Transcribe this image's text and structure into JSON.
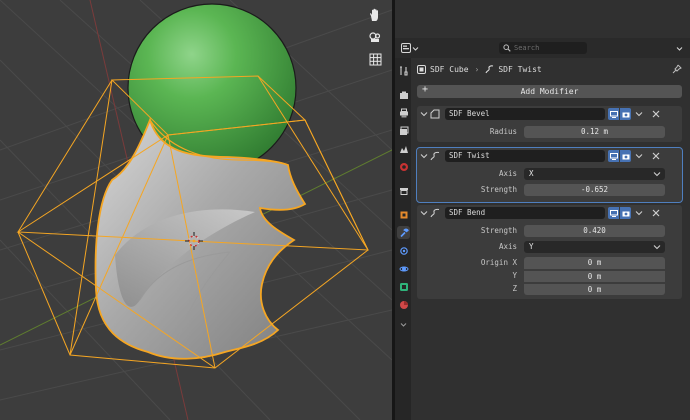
{
  "properties": {
    "search": {
      "placeholder": "Search"
    },
    "breadcrumb": {
      "object": "SDF Cube",
      "modifier": "SDF Twist"
    },
    "add_modifier_label": "Add Modifier",
    "tabs": [
      {
        "name": "tool-tab",
        "icon": "wrench-screwdriver-icon"
      },
      {
        "name": "render-tab",
        "icon": "camera-back-icon"
      },
      {
        "name": "output-tab",
        "icon": "printer-icon"
      },
      {
        "name": "view-layer-tab",
        "icon": "image-stack-icon"
      },
      {
        "name": "scene-tab",
        "icon": "scene-icon"
      },
      {
        "name": "world-tab",
        "icon": "world-icon"
      },
      {
        "name": "collection-tab",
        "icon": "collection-box-icon"
      },
      {
        "name": "object-tab",
        "icon": "object-square-icon"
      },
      {
        "name": "modifier-tab",
        "icon": "wrench-icon"
      },
      {
        "name": "particles-tab",
        "icon": "particles-icon"
      },
      {
        "name": "physics-tab",
        "icon": "physics-orbit-icon"
      },
      {
        "name": "constraints-tab",
        "icon": "constraint-icon"
      },
      {
        "name": "data-tab",
        "icon": "data-green-icon"
      },
      {
        "name": "material-tab",
        "icon": "material-sphere-icon"
      }
    ],
    "modifiers": [
      {
        "name": "SDF Bevel",
        "fields": [
          {
            "label": "Radius",
            "value": "0.12 m"
          }
        ]
      },
      {
        "name": "SDF Twist",
        "fields": [
          {
            "label": "Axis",
            "value": "X"
          },
          {
            "label": "Strength",
            "value": "-0.652"
          }
        ]
      },
      {
        "name": "SDF Bend",
        "fields": [
          {
            "label": "Strength",
            "value": "0.420"
          },
          {
            "label": "Axis",
            "value": "Y"
          },
          {
            "label": "Origin X",
            "value": "0 m"
          },
          {
            "label": "Y",
            "value": "0 m"
          },
          {
            "label": "Z",
            "value": "0 m"
          }
        ]
      }
    ]
  },
  "viewport": {
    "tools": [
      "hand-pan-icon",
      "camera-orbit-icon",
      "grid-view-icon"
    ]
  },
  "colors": {
    "accent_blue": "#4772b3",
    "selection_orange": "#f5a623",
    "sphere_green": "#4caf50",
    "active_panel_outline": "#4f7fbf"
  }
}
